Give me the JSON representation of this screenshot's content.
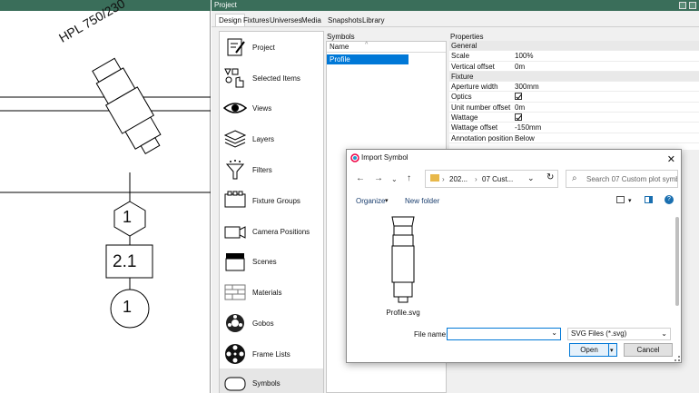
{
  "canvas": {
    "fixture_label": "HPL 750/230",
    "hex_number": "1",
    "box_number": "2.1",
    "circle_number": "1"
  },
  "project_window": {
    "title": "Project",
    "tabs": [
      "Design",
      "Fixtures",
      "Universes",
      "Media",
      "Snapshots",
      "Library"
    ],
    "active_tab": "Design"
  },
  "design_items": [
    {
      "label": "Project",
      "icon": "project-icon"
    },
    {
      "label": "Selected Items",
      "icon": "selected-items-icon"
    },
    {
      "label": "Views",
      "icon": "eye-icon"
    },
    {
      "label": "Layers",
      "icon": "layers-icon"
    },
    {
      "label": "Filters",
      "icon": "funnel-icon"
    },
    {
      "label": "Fixture Groups",
      "icon": "fixture-groups-icon"
    },
    {
      "label": "Camera Positions",
      "icon": "camera-icon"
    },
    {
      "label": "Scenes",
      "icon": "clapperboard-icon"
    },
    {
      "label": "Materials",
      "icon": "brick-icon"
    },
    {
      "label": "Gobos",
      "icon": "gobo-icon"
    },
    {
      "label": "Frame Lists",
      "icon": "film-reel-icon"
    },
    {
      "label": "Symbols",
      "icon": "symbol-icon"
    }
  ],
  "symbols_panel": {
    "title": "Symbols",
    "column_header": "Name",
    "rows": [
      "Profile"
    ]
  },
  "properties_panel": {
    "title": "Properties",
    "groups": [
      {
        "name": "General",
        "rows": [
          {
            "key": "Scale",
            "value": "100%"
          },
          {
            "key": "Vertical offset",
            "value": "0m"
          }
        ]
      },
      {
        "name": "Fixture",
        "rows": [
          {
            "key": "Aperture width",
            "value": "300mm"
          },
          {
            "key": "Optics",
            "checked": true
          },
          {
            "key": "Unit number offset",
            "value": "0m"
          },
          {
            "key": "Wattage",
            "checked": true
          },
          {
            "key": "Wattage offset",
            "value": "-150mm"
          },
          {
            "key": "Annotation position",
            "value": "Below"
          }
        ]
      }
    ]
  },
  "import_dialog": {
    "title": "Import Symbol",
    "path_parts": [
      "202...",
      "07 Cust..."
    ],
    "search_placeholder": "Search 07 Custom plot symb...",
    "organize_label": "Organize",
    "new_folder_label": "New folder",
    "file_item": "Profile.svg",
    "file_name_label": "File name:",
    "file_name_value": "",
    "file_type": "SVG Files (*.svg)",
    "open_label": "Open",
    "cancel_label": "Cancel"
  },
  "colors": {
    "titlebar": "#3a6e5a",
    "selection": "#0078d7"
  }
}
